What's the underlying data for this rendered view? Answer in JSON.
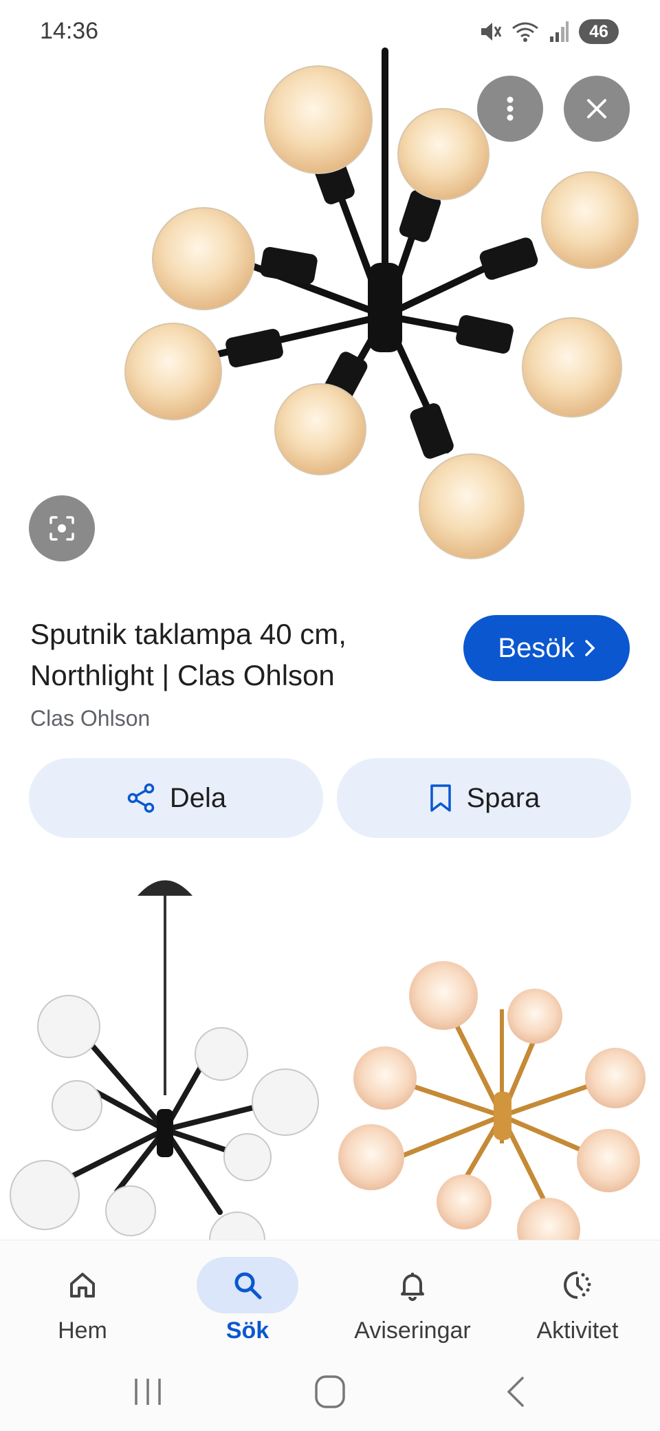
{
  "status_bar": {
    "time": "14:36",
    "battery": "46"
  },
  "result": {
    "title_line1": "Sputnik taklampa 40 cm,",
    "title_line2": "Northlight | Clas Ohlson",
    "source": "Clas Ohlson",
    "visit_label": "Besök"
  },
  "actions": {
    "share_label": "Dela",
    "save_label": "Spara"
  },
  "nav": {
    "items": [
      {
        "label": "Hem",
        "icon": "home-icon",
        "active": false
      },
      {
        "label": "Sök",
        "icon": "search-icon",
        "active": true
      },
      {
        "label": "Aviseringar",
        "icon": "bell-icon",
        "active": false
      },
      {
        "label": "Aktivitet",
        "icon": "activity-icon",
        "active": false
      }
    ]
  },
  "colors": {
    "accent": "#0b57d0",
    "pill_bg": "#e8effb",
    "overlay_btn": "#8a8a8a"
  }
}
